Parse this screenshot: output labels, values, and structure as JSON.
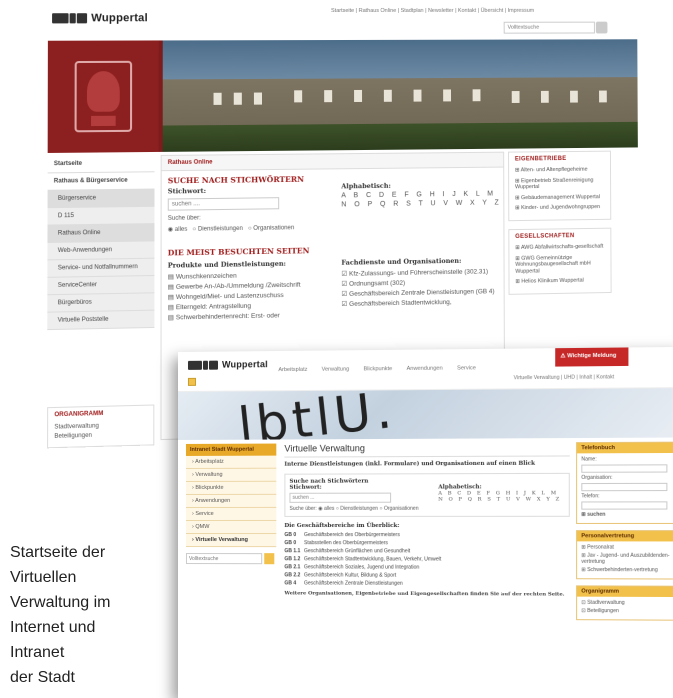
{
  "internet": {
    "logo": "Wuppertal",
    "toplinks": "Startseite | Rathaus Online | Stadtplan | Newsletter | Kontakt | Übersicht | Impressum",
    "search_placeholder": "Volltextsuche",
    "nav": [
      "Startseite",
      "Rathaus & Bürgerservice",
      "Bürgerservice",
      "D 115",
      "Rathaus Online",
      "Web-Anwendungen",
      "Service- und Notfallnummern",
      "ServiceCenter",
      "Bürgerbüros",
      "Virtuelle Poststelle"
    ],
    "organigramm": {
      "title": "ORGANIGRAMM",
      "items": [
        "Stadtverwaltung",
        "Beteiligungen"
      ]
    },
    "center": {
      "crumb": "Rathaus Online",
      "search_title": "SUCHE NACH STICHWÖRTERN",
      "stichwort_label": "Stichwort:",
      "stichwort_placeholder": "suchen ....",
      "alpha_label": "Alphabetisch:",
      "alpha_row1": "A B C D E F G H I J K L M",
      "alpha_row2": "N O P Q R S T U V W X Y Z",
      "suche_ueber": "Suche über:",
      "radios": [
        "alles",
        "Dienstleistungen",
        "Organisationen"
      ],
      "most_title": "DIE MEIST BESUCHTEN SEITEN",
      "col1_title": "Produkte und Dienstleistungen:",
      "col1": [
        "Wunschkennzeichen",
        "Gewerbe An-/Ab-/Ummeldung /Zweitschrift",
        "Wohngeld/Miet- und Lastenzuschuss",
        "Elterngeld: Antragstellung",
        "Schwerbehindertenrecht: Erst- oder"
      ],
      "col2_title": "Fachdienste und Organisationen:",
      "col2": [
        "Kfz-Zulassungs- und Führerscheinstelle (302.31)",
        "Ordnungsamt (302)",
        "Geschäftsbereich Zentrale Dienstleistungen (GB 4)",
        "Geschäftsbereich Stadtentwicklung,"
      ]
    },
    "eigenbetriebe": {
      "title": "EIGENBETRIEBE",
      "items": [
        "Alten- und Altenpflegeheime",
        "Eigenbetrieb Straßenreinigung Wuppertal",
        "Gebäudemanagement Wuppertal",
        "Kinder- und Jugendwohngruppen"
      ]
    },
    "gesellschaften": {
      "title": "GESELLSCHAFTEN",
      "items": [
        "AWG Abfallwirtschafts-gesellschaft",
        "GWG Gemeinnützige Wohnungsbaugesellschaft mbH Wuppertal",
        "Helios Klinikum Wuppertal"
      ]
    }
  },
  "intranet": {
    "logo": "Wuppertal",
    "menu": [
      "Arbeitsplatz",
      "Verwaltung",
      "Blickpunkte",
      "Anwendungen",
      "Service"
    ],
    "alert": "Wichtige Meldung",
    "sublinks": "Virtuelle Verwaltung | UHD | Inhalt | Kontakt",
    "hero_text": "lbtlU.",
    "left_head": "Intranet Stadt Wuppertal",
    "left_items": [
      "Arbeitsplatz",
      "Verwaltung",
      "Blickpunkte",
      "Anwendungen",
      "Service",
      "QMW",
      "Virtuelle Verwaltung"
    ],
    "left_search": "Volltextsuche",
    "title": "Virtuelle Verwaltung",
    "intro": "Interne Dienstleistungen (inkl. Formulare) und Organisationen auf einen Blick",
    "search_title": "Suche nach Stichwörtern",
    "stichwort": "Stichwort:",
    "stichwort_placeholder": "suchen ...",
    "alpha_label": "Alphabetisch:",
    "alpha1": "A B C D E F G H I J K L M",
    "alpha2": "N O P Q R S T U V W X Y Z",
    "radios": "Suche über:  ◉ alles   ○ Dienstleistungen   ○ Organisationen",
    "bereiche_title": "Die Geschäftsbereiche im Überblick:",
    "bereiche": [
      {
        "code": "GB 0",
        "name": "Geschäftsbereich des Oberbürgermeisters"
      },
      {
        "code": "GB 0",
        "name": "Stabsstellen des Oberbürgermeisters"
      },
      {
        "code": "GB 1.1",
        "name": "Geschäftsbereich Grünflächen und Gesundheit"
      },
      {
        "code": "GB 1.2",
        "name": "Geschäftsbereich Stadtentwicklung, Bauen, Verkehr, Umwelt"
      },
      {
        "code": "GB 2.1",
        "name": "Geschäftsbereich Soziales, Jugend und Integration"
      },
      {
        "code": "GB 2.2",
        "name": "Geschäftsbereich Kultur, Bildung & Sport"
      },
      {
        "code": "GB 4",
        "name": "Geschäftsbereich Zentrale Dienstleistungen"
      }
    ],
    "more": "Weitere Organisationen, Eigenbetriebe und Eigengesellschaften finden Sie auf der rechten Seite.",
    "telefonbuch": {
      "title": "Telefonbuch",
      "fields": [
        "Name:",
        "Organisation:",
        "Telefon:"
      ],
      "button": "suchen"
    },
    "personal": {
      "title": "Personalvertretung",
      "items": [
        "Personalrat",
        "Jav - Jugend- und Auszubildenden-vertretung",
        "Schwerbehinderten-vertretung"
      ]
    },
    "organigramm": {
      "title": "Organigramm",
      "items": [
        "Stadtverwaltung",
        "Beteiligungen"
      ]
    }
  },
  "caption": [
    "Startseite der",
    "Virtuellen",
    "Verwaltung im",
    "Internet und",
    "Intranet",
    "der Stadt"
  ]
}
